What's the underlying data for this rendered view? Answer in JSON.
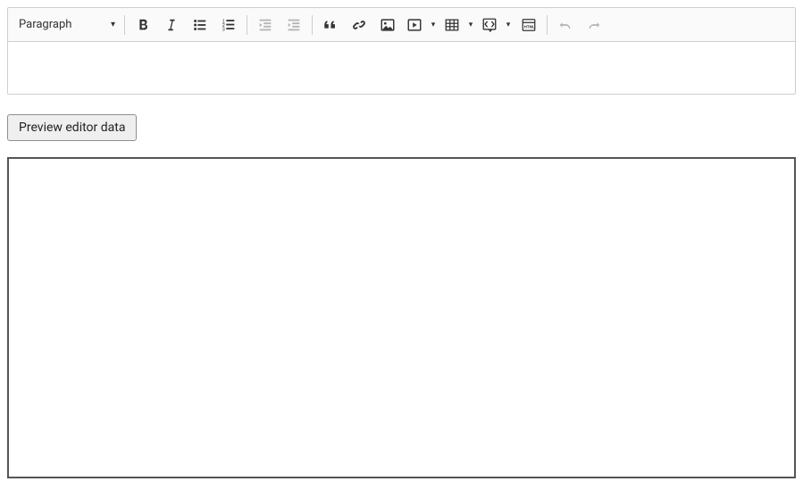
{
  "toolbar": {
    "heading_label": "Paragraph"
  },
  "buttons": {
    "preview": "Preview editor data"
  },
  "editor_content": "",
  "preview_content": ""
}
